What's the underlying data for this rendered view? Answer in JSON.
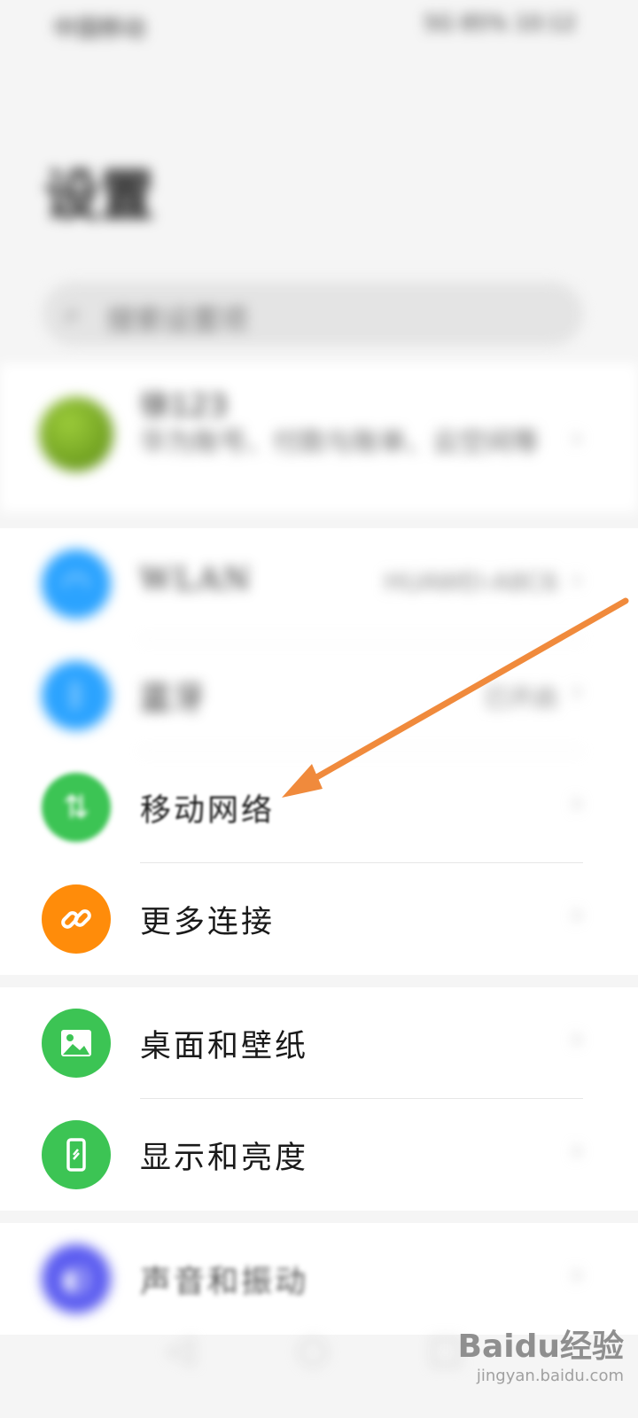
{
  "status_bar": {
    "left_text": "中国移动",
    "right_text": "5G 85% 10:12"
  },
  "header": {
    "title": "设置"
  },
  "search": {
    "placeholder": "搜索设置项"
  },
  "account": {
    "name": "徐123",
    "description": "华为账号、付款与账单、云空间等"
  },
  "groups": [
    {
      "items": [
        {
          "label": "WLAN",
          "value": "HUAWEI-A8C6",
          "icon": "wifi-icon",
          "color": "#2ba3ff"
        },
        {
          "label": "蓝牙",
          "value": "已开启",
          "icon": "bluetooth-icon",
          "color": "#2ba3ff"
        },
        {
          "label": "移动网络",
          "value": "",
          "icon": "mobile-data-icon",
          "color": "#3cc454"
        },
        {
          "label": "更多连接",
          "value": "",
          "icon": "link-icon",
          "color": "#ff8c0a"
        }
      ]
    },
    {
      "items": [
        {
          "label": "桌面和壁纸",
          "value": "",
          "icon": "image-icon",
          "color": "#3cc454"
        },
        {
          "label": "显示和亮度",
          "value": "",
          "icon": "phone-display-icon",
          "color": "#3cc454"
        }
      ]
    },
    {
      "items": [
        {
          "label": "声音和振动",
          "value": "",
          "icon": "sound-icon",
          "color": "#5b5cf0"
        }
      ]
    }
  ],
  "chevron": "›",
  "annotation": {
    "color": "#f08a3c"
  },
  "watermark": {
    "brand": "Baidu经验",
    "url": "jingyan.baidu.com"
  }
}
